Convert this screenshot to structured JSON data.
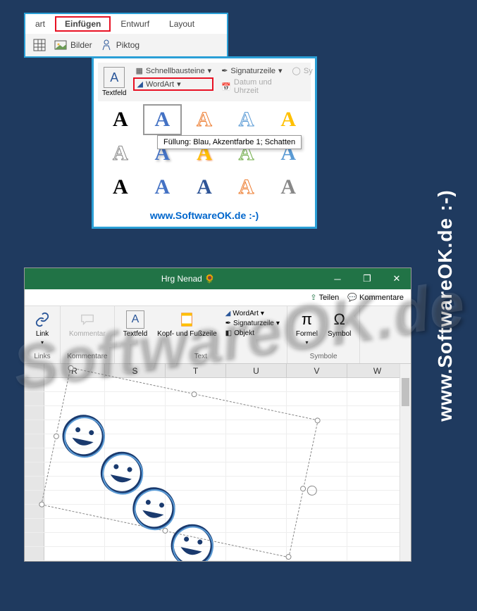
{
  "watermark_side": "www.SoftwareOK.de :-)",
  "watermark_bg": "SoftwareOK.de",
  "word": {
    "tabs": [
      "art",
      "Einfügen",
      "Entwurf",
      "Layout"
    ],
    "active_tab_index": 1,
    "ribbon_items": {
      "bilder": "Bilder",
      "piktog": "Piktog"
    }
  },
  "wordart": {
    "textfeld": "Textfeld",
    "textfeld_letter": "A",
    "top_items": {
      "schnellbausteine": "Schnellbausteine",
      "wordart": "WordArt",
      "signaturzeile": "Signaturzeile",
      "datum": "Datum und Uhrzeit",
      "sy": "Sy"
    },
    "tooltip": "Füllung: Blau, Akzentfarbe 1; Schatten",
    "footer": "www.SoftwareOK.de :-)"
  },
  "excel": {
    "title": "Hrg Nenad",
    "share": "Teilen",
    "comments": "Kommentare",
    "groups": {
      "link": "Link",
      "links_label": "Links",
      "kommentar": "Kommentar",
      "kommentare_label": "Kommentare",
      "textfeld": "Textfeld",
      "kopf_fuss": "Kopf- und Fußzeile",
      "wordart": "WordArt",
      "signaturzeile": "Signaturzeile",
      "objekt": "Objekt",
      "text_label": "Text",
      "formel": "Formel",
      "symbol": "Symbol",
      "symbole_label": "Symbole"
    },
    "columns": [
      "R",
      "S",
      "T",
      "U",
      "V",
      "W"
    ]
  }
}
